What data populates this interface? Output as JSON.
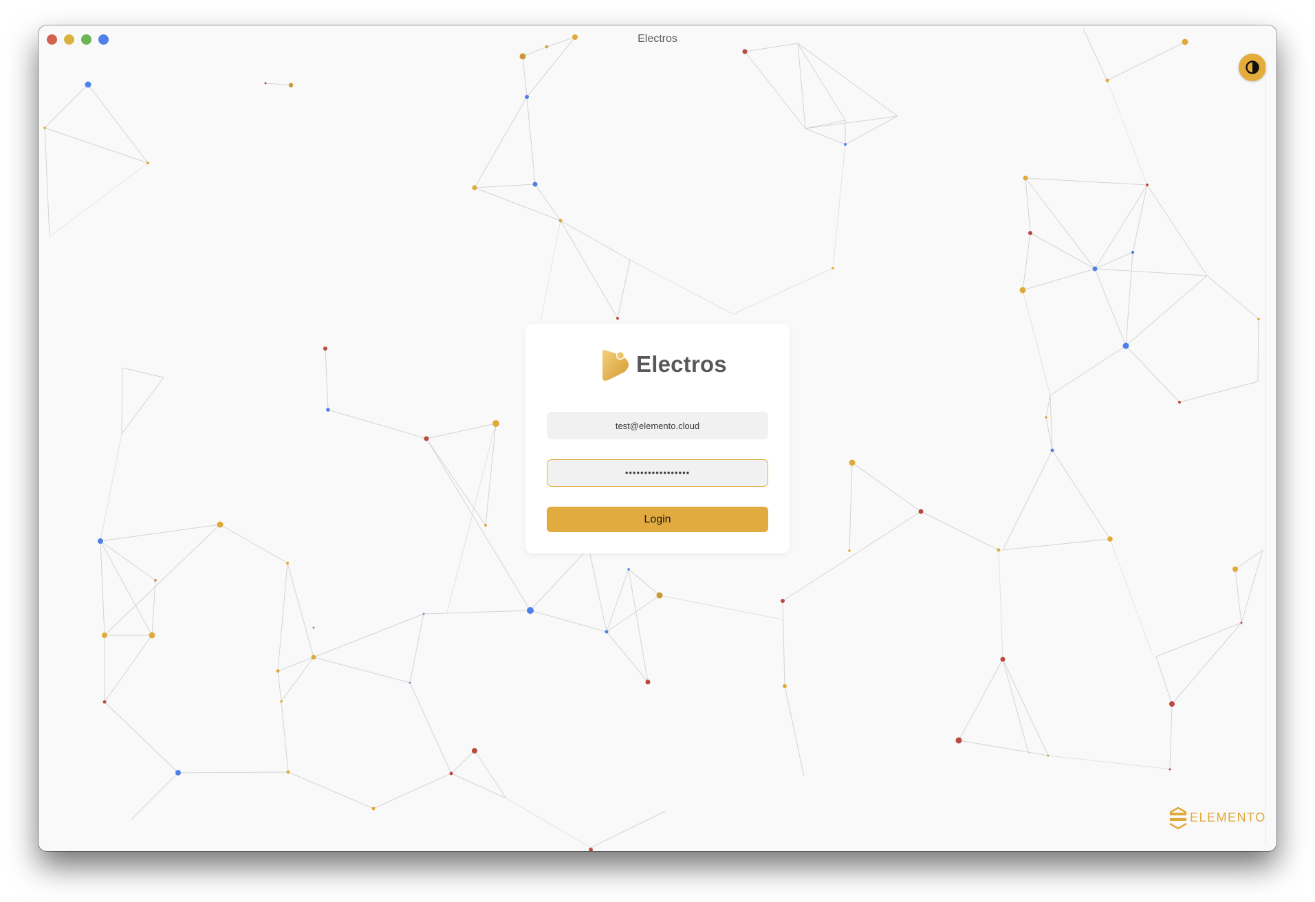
{
  "window": {
    "title": "Electros"
  },
  "header": {
    "theme_toggle_icon": "contrast-icon"
  },
  "login": {
    "brand_name": "Electros",
    "brand_icon": "electros-logo-icon",
    "email_value": "test@elemento.cloud",
    "password_value": "•••••••••••••••••",
    "login_label": "Login"
  },
  "footer": {
    "company_logo_icon": "elemento-logo-icon",
    "company_name": "ELEMENTO"
  },
  "colors": {
    "accent": "#e1ab3f",
    "node_gold": "#e0a93a",
    "node_blue": "#4f7fe8",
    "node_red": "#b84a3e",
    "background": "#f9f9f9"
  }
}
